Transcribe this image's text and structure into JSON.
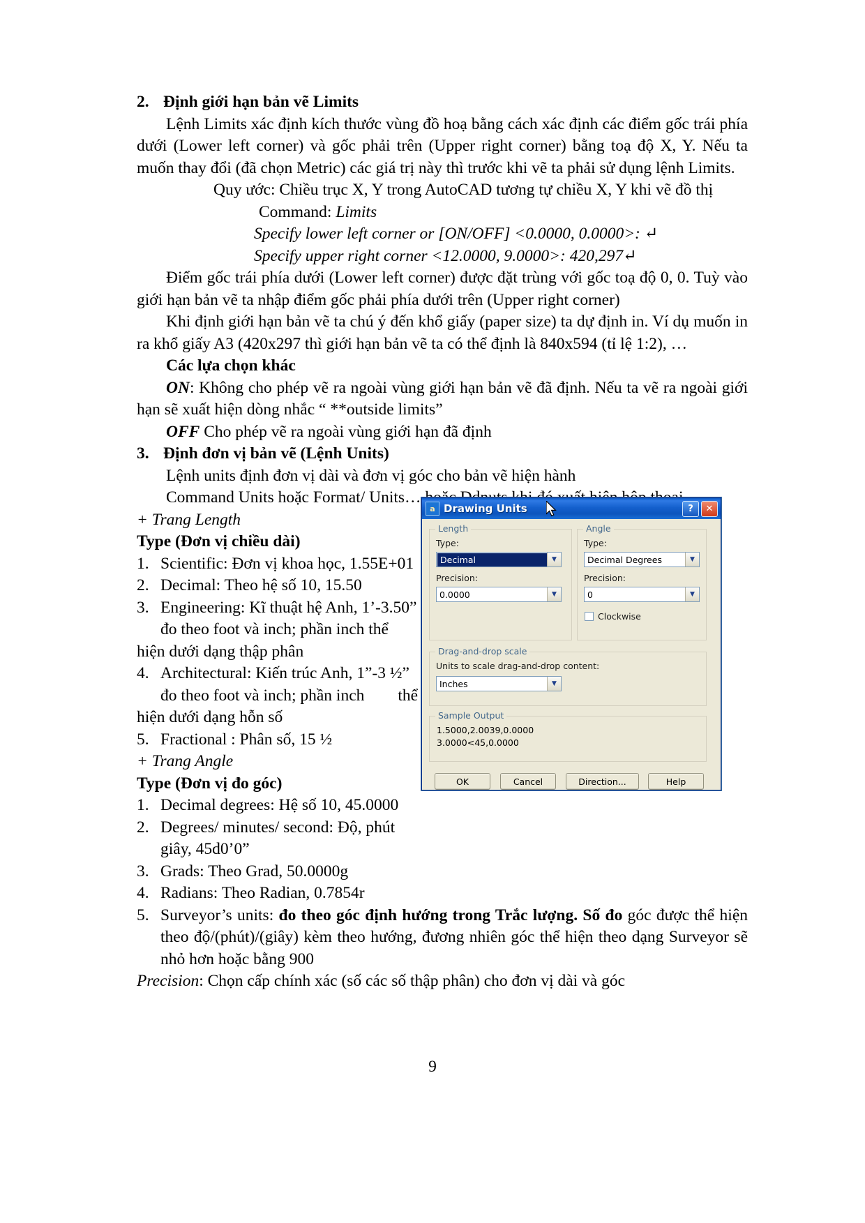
{
  "page": {
    "number": "9"
  },
  "section2": {
    "number": "2.",
    "heading": "Định giới hạn bản vẽ Limits",
    "para1": "Lệnh Limits xác định kích thước vùng  đồ hoạ bằng cách xác định các điểm gốc trái phía dưới (Lower left corner) và gốc phải trên (Upper right corner) bằng toạ độ X, Y. Nếu ta muốn thay đổi (đã chọn Metric) các giá trị này thì trước khi vẽ ta phải sử dụng lệnh Limits.",
    "quyuoc": "Quy ước: Chiều trục X, Y trong AutoCAD tương tự chiều X, Y khi vẽ đồ thị",
    "command_label": "Command: ",
    "command_value": "Limits",
    "prompt1": "Specify lower left corner or [ON/OFF] <0.0000, 0.0000>: ↵",
    "prompt2": "Specify upper right corner <12.0000, 9.0000>: 420,297↵",
    "para2": "Điểm gốc trái phía dưới (Lower left corner) được đặt trùng với gốc toạ độ 0, 0. Tuỳ vào giới hạn bản vẽ ta nhập điểm gốc phải phía dưới trên (Upper right corner)",
    "para3": "Khi định giới hạn bản vẽ ta chú ý đến khổ giấy (paper size) ta dự định in. Ví dụ muốn in ra khổ giấy A3 (420x297 thì giới hạn bản vẽ ta có thể định là 840x594 (tỉ lệ 1:2), …",
    "options_heading": "Các lựa chọn khác",
    "on_label": "ON",
    "on_text": ": Không cho phép vẽ ra ngoài vùng giới hạn bản vẽ đã định. Nếu ta vẽ ra ngoài giới hạn sẽ xuất hiện dòng nhắc “ **outside limits”",
    "off_label": "OFF",
    "off_text": " Cho phép vẽ ra ngoài vùng giới hạn đã định"
  },
  "section3": {
    "number": "3.",
    "heading": "Định đơn vị bản vẽ (Lệnh Units)",
    "para1": "Lệnh units định đơn vị dài và đơn vị góc cho bản vẽ hiện hành",
    "para2": "Command Units hoặc Format/ Units… hoặc Ddnuts  khi đó xuất hiện hộp thoại",
    "trang_length": "+ Trang Length",
    "type_length_heading": "Type (Đơn vị chiều dài)",
    "length_items": [
      {
        "n": "1.",
        "text": "Scientific: Đơn vị khoa học, 1.55E+01"
      },
      {
        "n": "2.",
        "text": "Decimal: Theo hệ số 10, 15.50"
      },
      {
        "n": "3.",
        "text": "Engineering: Kĩ thuật hệ Anh, 1’-3.50”"
      },
      {
        "n": "4.",
        "text": "Architectural: Kiến trúc Anh, 1”-3 ½”"
      },
      {
        "n": "5.",
        "text": "Fractional : Phân số, 15 ½"
      }
    ],
    "eng_note_a": "đo theo foot và inch; phần inch thể",
    "eng_note_b": "hiện dưới dạng thập phân",
    "arch_note_a": "đo theo foot và inch; phần inch",
    "arch_note_a_tail": "thể",
    "arch_note_b": "hiện dưới dạng hỗn số",
    "trang_angle": "+ Trang Angle",
    "type_angle_heading": "Type (Đơn vị đo góc)",
    "angle_items": [
      {
        "n": "1.",
        "text": "Decimal degrees: Hệ số 10, 45.0000"
      },
      {
        "n": "2.",
        "text": "Degrees/ minutes/ second: Độ, phút"
      },
      {
        "n": "3.",
        "text": "Grads: Theo Grad, 50.0000g"
      },
      {
        "n": "4.",
        "text": "Radians: Theo Radian, 0.7854r"
      }
    ],
    "angle2_cont": "giây, 45d0’0”",
    "surveyor_num": "5.",
    "surveyor_lead": "Surveyor’s units: ",
    "surveyor_bold1": "đo theo góc định hướng trong Trắc lượng. Số đo",
    "surveyor_rest": " góc được thể hiện theo độ/(phút)/(giây) kèm theo hướng, đương nhiên góc thể hiện theo dạng Surveyor sẽ nhỏ hơn hoặc bằng 900",
    "precision_label": "Precision",
    "precision_text": ": Chọn cấp chính xác (số các số thập phân) cho đơn vị dài và góc"
  },
  "dialog": {
    "title": "Drawing Units",
    "icon_glyph": "a",
    "help_btn": "?",
    "close_btn": "✕",
    "length_group": "Length",
    "length_type_label": "Type:",
    "length_type_value": "Decimal",
    "length_precision_label": "Precision:",
    "length_precision_value": "0.0000",
    "angle_group": "Angle",
    "angle_type_label": "Type:",
    "angle_type_value": "Decimal Degrees",
    "angle_precision_label": "Precision:",
    "angle_precision_value": "0",
    "clockwise_label": "Clockwise",
    "dragdrop_group": "Drag-and-drop scale",
    "dragdrop_label": "Units to scale drag-and-drop content:",
    "dragdrop_value": "Inches",
    "sample_group": "Sample Output",
    "sample_line1": "1.5000,2.0039,0.0000",
    "sample_line2": "3.0000<45,0.0000",
    "buttons": {
      "ok": "OK",
      "cancel": "Cancel",
      "direction": "Direction...",
      "help": "Help"
    },
    "colors": {
      "titlebar": "#1460cd",
      "face": "#ece9d8",
      "selection": "#0a246a",
      "group_label": "#43688c"
    }
  }
}
